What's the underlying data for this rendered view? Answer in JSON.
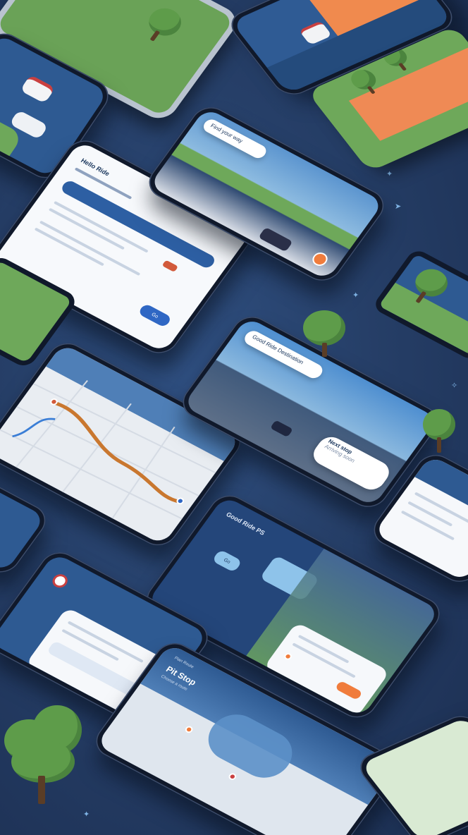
{
  "scene": {
    "colors": {
      "background": "#263f68",
      "bezel": "#10192b",
      "accent_blue": "#2f67c4",
      "accent_orange": "#f07c3c",
      "grass": "#6ea85a",
      "map": "#e9edf2",
      "route": "#c9772f"
    }
  },
  "screens": {
    "card_one": {
      "greeting": "Hello Ride",
      "button": "Go"
    },
    "skyline_banner": {
      "bubble": "Find your way"
    },
    "city_drive": {
      "bubble": "Good Ride Destination",
      "pill_title": "Next stop",
      "pill_sub": "Arriving soon"
    },
    "dark_panel": {
      "header": "Good Ride PS",
      "chip": "Go"
    },
    "bottom_map": {
      "header": "Plan Route",
      "title": "Pit Stop",
      "subtitle": "Choose a route"
    }
  },
  "icons": [
    "car-icon",
    "map-pin-icon",
    "tree-icon",
    "route-icon",
    "arrow-icon"
  ]
}
